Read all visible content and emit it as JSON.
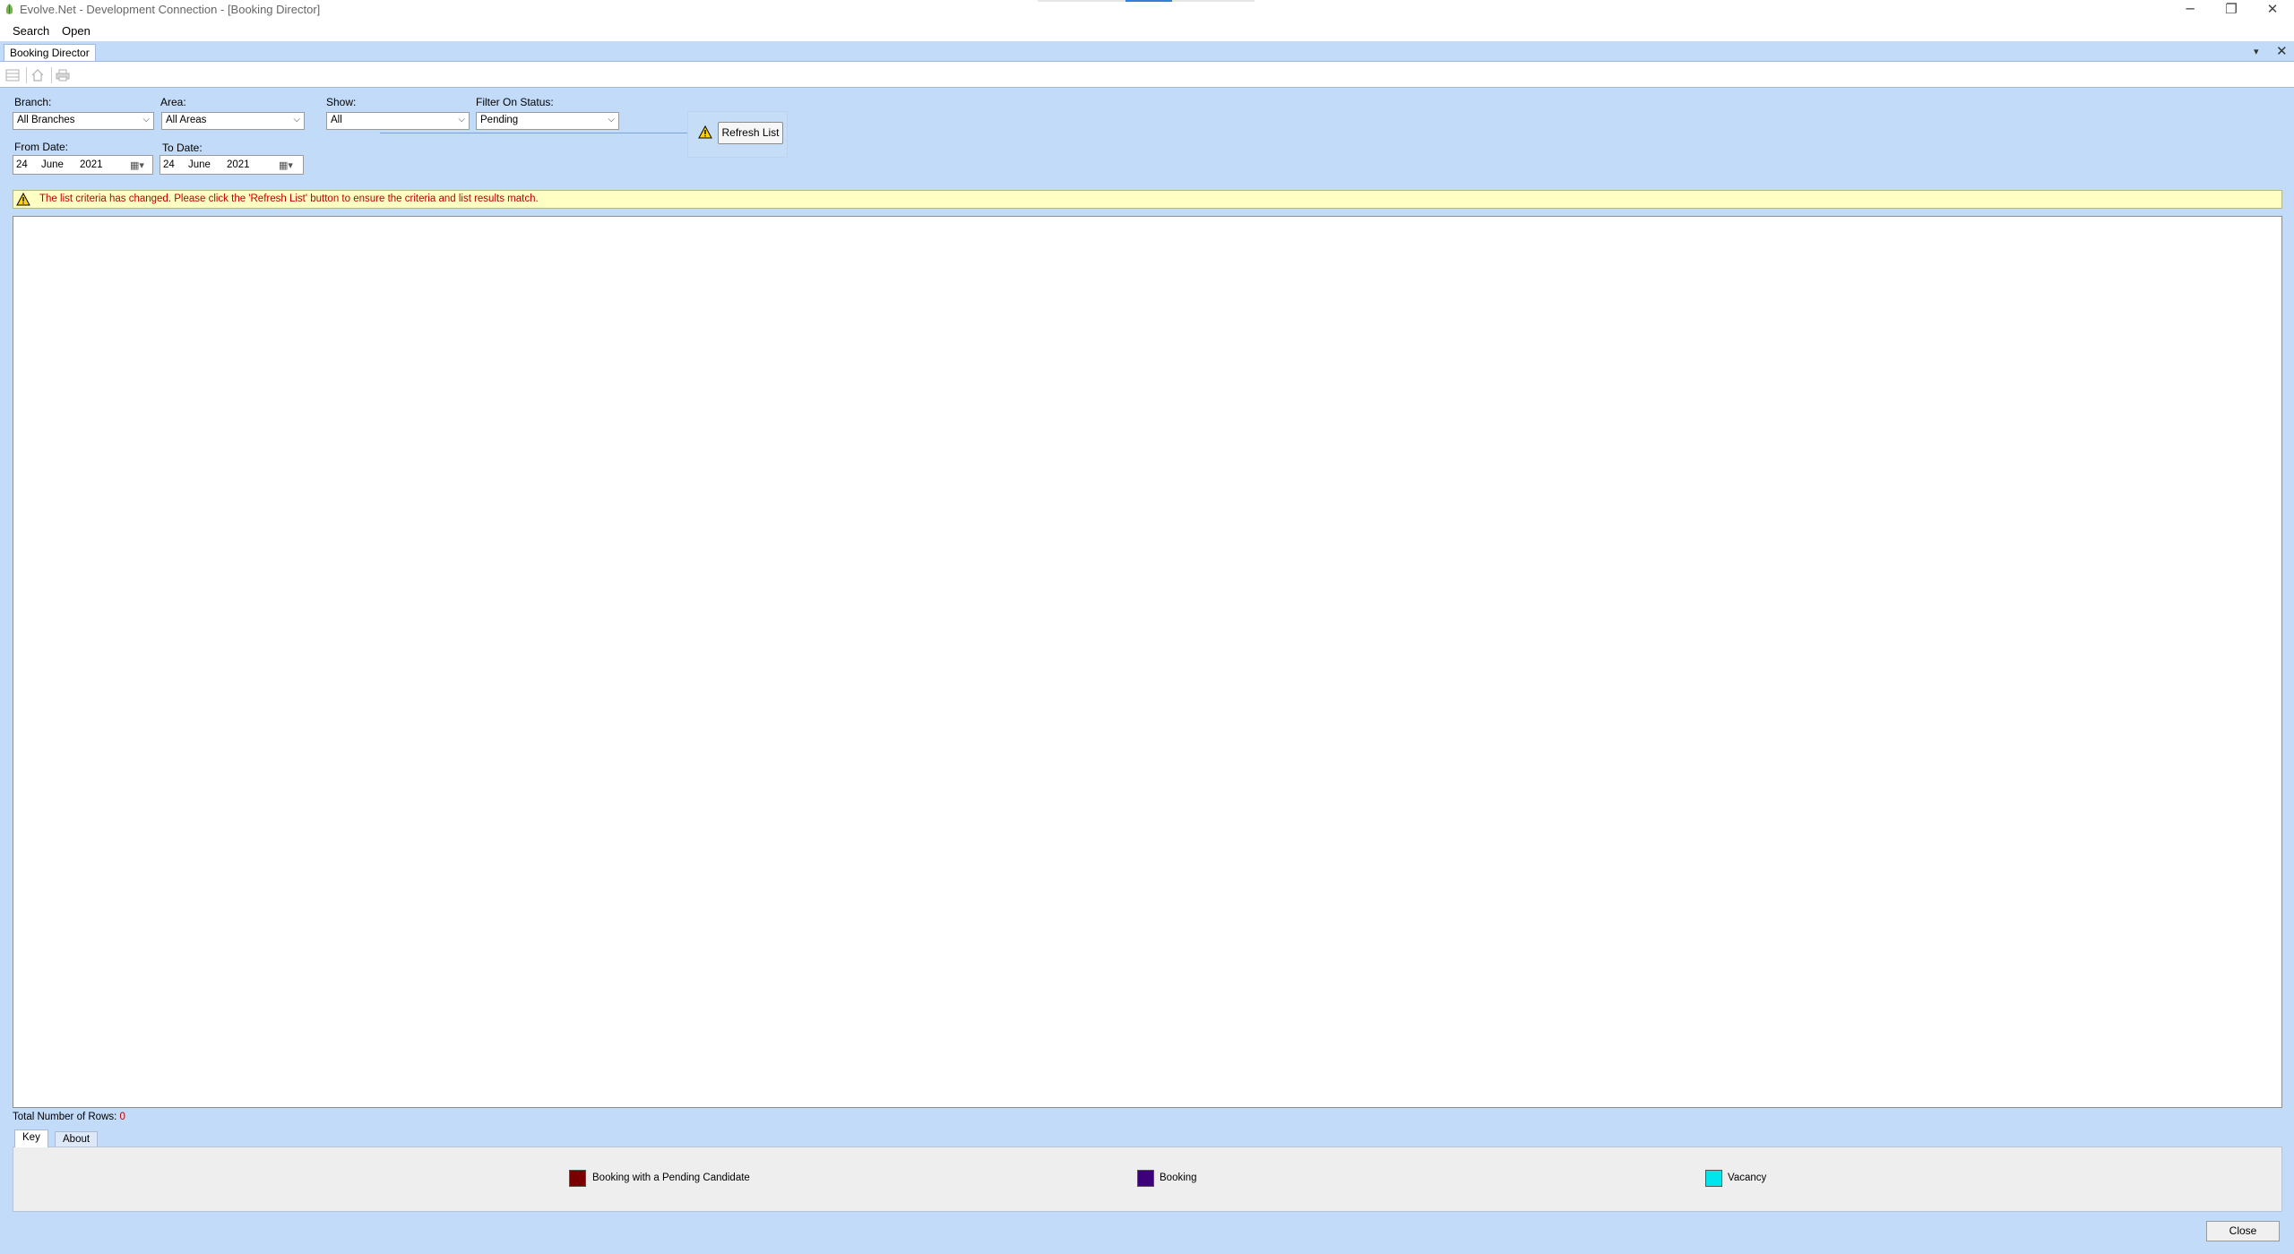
{
  "window": {
    "title": "Evolve.Net - Development Connection - [Booking Director]",
    "controls": {
      "minimize": "─",
      "restore": "❐",
      "close": "✕"
    }
  },
  "menu": {
    "search_label": "Search",
    "open_label": "Open"
  },
  "document": {
    "tab_label": "Booking Director",
    "dropdown_icon": "▾",
    "close_icon": "✕"
  },
  "toolbar": {
    "icons": [
      "grid-icon",
      "home-icon",
      "print-icon"
    ]
  },
  "filters": {
    "branch": {
      "label": "Branch:",
      "value": "All Branches"
    },
    "area": {
      "label": "Area:",
      "value": "All Areas"
    },
    "show": {
      "label": "Show:",
      "value": "All"
    },
    "status": {
      "label": "Filter On Status:",
      "value": "Pending"
    },
    "from_date": {
      "label": "From Date:",
      "day": "24",
      "month": "June",
      "year": "2021"
    },
    "to_date": {
      "label": "To Date:",
      "day": "24",
      "month": "June",
      "year": "2021"
    },
    "refresh_label": "Refresh List"
  },
  "warning": {
    "text": "The list criteria has changed.  Please click the 'Refresh List' button to ensure the criteria and list results match.",
    "color": "#c00000"
  },
  "list": {
    "rows_label": "Total Number of Rows:",
    "rows_count": "0"
  },
  "bottom_tabs": {
    "key_label": "Key",
    "about_label": "About"
  },
  "key": {
    "items": [
      {
        "label": "Booking with a Pending Candidate",
        "color": "#7a0000"
      },
      {
        "label": "Booking",
        "color": "#3d007a"
      },
      {
        "label": "Vacancy",
        "color": "#00e5ee"
      }
    ]
  },
  "footer": {
    "close_label": "Close"
  },
  "colors": {
    "background": "#c2dbf9",
    "warning_bg": "#ffffc4"
  }
}
